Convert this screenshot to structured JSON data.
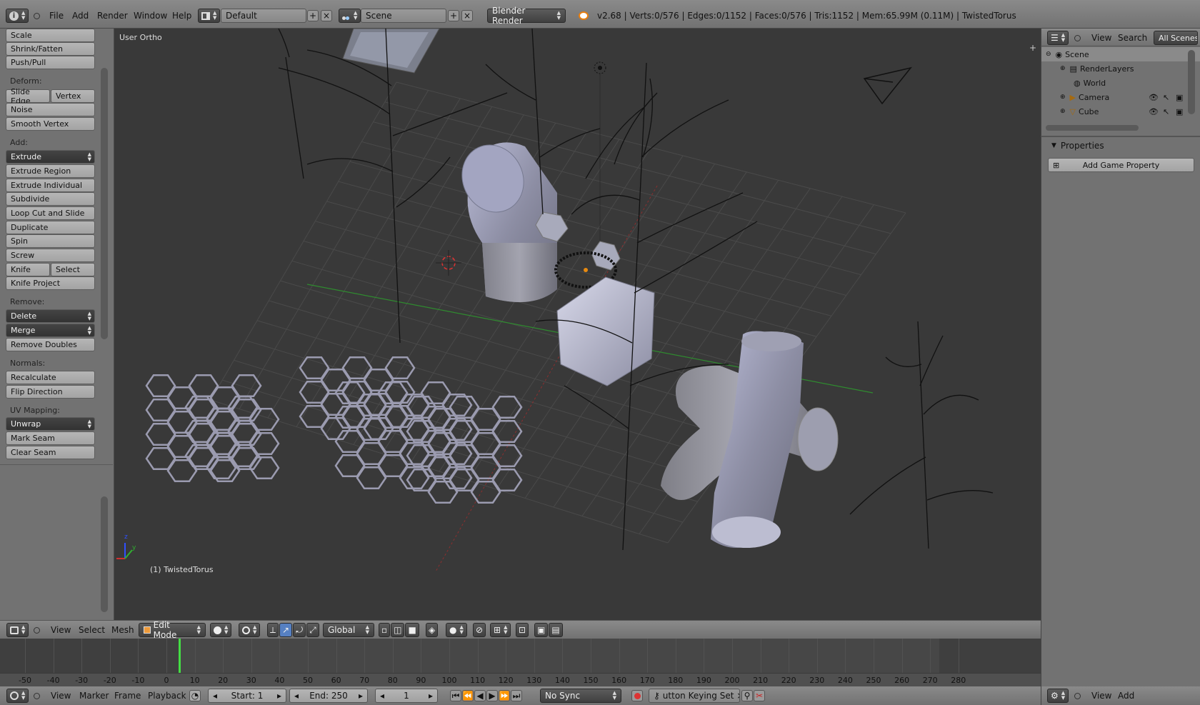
{
  "topbar": {
    "menus": [
      "File",
      "Add",
      "Render",
      "Window",
      "Help"
    ],
    "layout_name": "Default",
    "scene_name": "Scene",
    "render_engine": "Blender Render",
    "stats": "v2.68 | Verts:0/576 | Edges:0/1152 | Faces:0/576 | Tris:1152 | Mem:65.99M (0.11M) | TwistedTorus"
  },
  "toolshelf": {
    "transform": [
      "Scale",
      "Shrink/Fatten",
      "Push/Pull"
    ],
    "deform_label": "Deform:",
    "slide_edge": "Slide Edge",
    "vertex": "Vertex",
    "deform": [
      "Noise",
      "Smooth Vertex"
    ],
    "add_label": "Add:",
    "extrude": "Extrude",
    "add": [
      "Extrude Region",
      "Extrude Individual",
      "Subdivide",
      "Loop Cut and Slide",
      "Duplicate",
      "Spin",
      "Screw"
    ],
    "knife": "Knife",
    "select": "Select",
    "knife_project": "Knife Project",
    "remove_label": "Remove:",
    "delete": "Delete",
    "merge": "Merge",
    "remove_doubles": "Remove Doubles",
    "normals_label": "Normals:",
    "normals": [
      "Recalculate",
      "Flip Direction"
    ],
    "uv_label": "UV Mapping:",
    "unwrap": "Unwrap",
    "uv": [
      "Mark Seam",
      "Clear Seam"
    ]
  },
  "viewport": {
    "view_name": "User Ortho",
    "object_label": "(1) TwistedTorus",
    "axis_z": "z",
    "axis_x": "x",
    "axis_y": "y"
  },
  "view3d_header": {
    "view": "View",
    "select": "Select",
    "mesh": "Mesh",
    "mode": "Edit Mode",
    "orientation": "Global"
  },
  "timeline": {
    "ruler": [
      "-50",
      "-40",
      "-30",
      "-20",
      "-10",
      "0",
      "10",
      "20",
      "30",
      "40",
      "50",
      "60",
      "70",
      "80",
      "90",
      "100",
      "110",
      "120",
      "130",
      "140",
      "150",
      "160",
      "170",
      "180",
      "190",
      "200",
      "210",
      "220",
      "230",
      "240",
      "250",
      "260",
      "270",
      "280"
    ],
    "current_frame_marker": 0,
    "menus": [
      "View",
      "Marker",
      "Frame",
      "Playback"
    ],
    "start": "Start: 1",
    "end": "End: 250",
    "current": "1",
    "sync": "No Sync",
    "keying_set": "utton Keying Set"
  },
  "outliner": {
    "header_view": "View",
    "header_search": "Search",
    "header_scope": "All Scenes",
    "items": [
      {
        "label": "Scene",
        "indent": 0
      },
      {
        "label": "RenderLayers",
        "indent": 1
      },
      {
        "label": "World",
        "indent": 1
      },
      {
        "label": "Camera",
        "indent": 1
      },
      {
        "label": "Cube",
        "indent": 1
      }
    ]
  },
  "properties": {
    "title": "Properties",
    "add_game_property": "Add Game Property",
    "footer_view": "View",
    "footer_add": "Add"
  },
  "colors": {
    "header": "#7a7a7a",
    "panel": "#727272",
    "viewport": "#393939",
    "timeline": "#474747",
    "accent_frame": "#44dd44",
    "axis_x": "#c03030",
    "axis_y": "#30a030"
  }
}
